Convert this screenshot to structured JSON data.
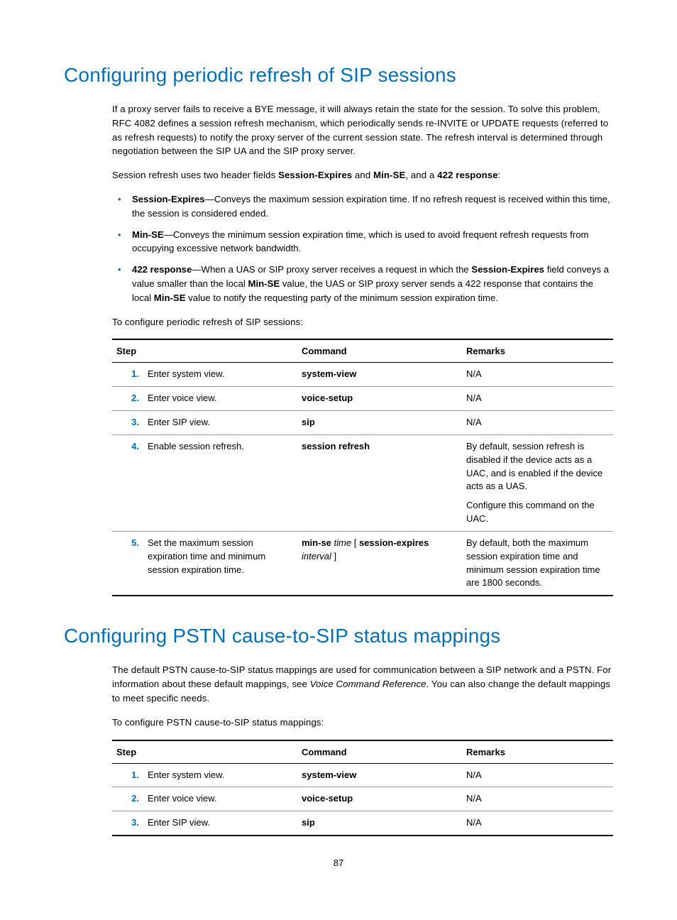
{
  "section1": {
    "heading": "Configuring periodic refresh of SIP sessions",
    "intro": "If a proxy server fails to receive a BYE message, it will always retain the state for the session. To solve this problem, RFC 4082 defines a session refresh mechanism, which periodically sends re-INVITE or UPDATE requests (referred to as refresh requests) to notify the proxy server of the current session state. The refresh interval is determined through negotiation between the SIP UA and the SIP proxy server.",
    "para2_pre": "Session refresh uses two header fields ",
    "para2_b1": "Session-Expires",
    "para2_mid1": " and ",
    "para2_b2": "Min-SE",
    "para2_mid2": ", and a ",
    "para2_b3": "422 response",
    "para2_post": ":",
    "bullet1_b": "Session-Expires",
    "bullet1_t": "—Conveys the maximum session expiration time. If no refresh request is received within this time, the session is considered ended.",
    "bullet2_b": "Min-SE",
    "bullet2_t": "—Conveys the minimum session expiration time, which is used to avoid frequent refresh requests from occupying excessive network bandwidth.",
    "bullet3_b1": "422 response",
    "bullet3_t1": "—When a UAS or SIP proxy server receives a request in which the ",
    "bullet3_b2": "Session-Expires",
    "bullet3_t2": " field conveys a value smaller than the local ",
    "bullet3_b3": "Min-SE",
    "bullet3_t3": " value, the UAS or SIP proxy server sends a 422 response that contains the local ",
    "bullet3_b4": "Min-SE",
    "bullet3_t4": " value to notify the requesting party of the minimum session expiration time.",
    "lead": "To configure periodic refresh of SIP sessions:",
    "table": {
      "headers": {
        "step": "Step",
        "command": "Command",
        "remarks": "Remarks"
      },
      "rows": [
        {
          "num": "1.",
          "step": "Enter system view.",
          "cmd_b1": "system-view",
          "remarks": "N/A"
        },
        {
          "num": "2.",
          "step": "Enter voice view.",
          "cmd_b1": "voice-setup",
          "remarks": "N/A"
        },
        {
          "num": "3.",
          "step": "Enter SIP view.",
          "cmd_b1": "sip",
          "remarks": "N/A"
        },
        {
          "num": "4.",
          "step": "Enable session refresh.",
          "cmd_b1": "session refresh",
          "remarks1": "By default, session refresh is disabled if the device acts as a UAC, and is enabled if the device acts as a UAS.",
          "remarks2": "Configure this command on the UAC."
        },
        {
          "num": "5.",
          "step": "Set the maximum session expiration time and minimum session expiration time.",
          "cmd_b1": "min-se",
          "cmd_i1": " time ",
          "cmd_t1": "[ ",
          "cmd_b2": "session-expires",
          "cmd_i2": " interval ",
          "cmd_t2": "]",
          "remarks": "By default, both the maximum session expiration time and minimum session expiration time are 1800 seconds."
        }
      ]
    }
  },
  "section2": {
    "heading": "Configuring PSTN cause-to-SIP status mappings",
    "intro_pre": "The default PSTN cause-to-SIP status mappings are used for communication between a SIP network and a PSTN. For information about these default mappings, see ",
    "intro_i": "Voice Command Reference",
    "intro_post": ". You can also change the default mappings to meet specific needs.",
    "lead": "To configure PSTN cause-to-SIP status mappings:",
    "table": {
      "headers": {
        "step": "Step",
        "command": "Command",
        "remarks": "Remarks"
      },
      "rows": [
        {
          "num": "1.",
          "step": "Enter system view.",
          "cmd_b1": "system-view",
          "remarks": "N/A"
        },
        {
          "num": "2.",
          "step": "Enter voice view.",
          "cmd_b1": "voice-setup",
          "remarks": "N/A"
        },
        {
          "num": "3.",
          "step": "Enter SIP view.",
          "cmd_b1": "sip",
          "remarks": "N/A"
        }
      ]
    }
  },
  "pageNumber": "87"
}
